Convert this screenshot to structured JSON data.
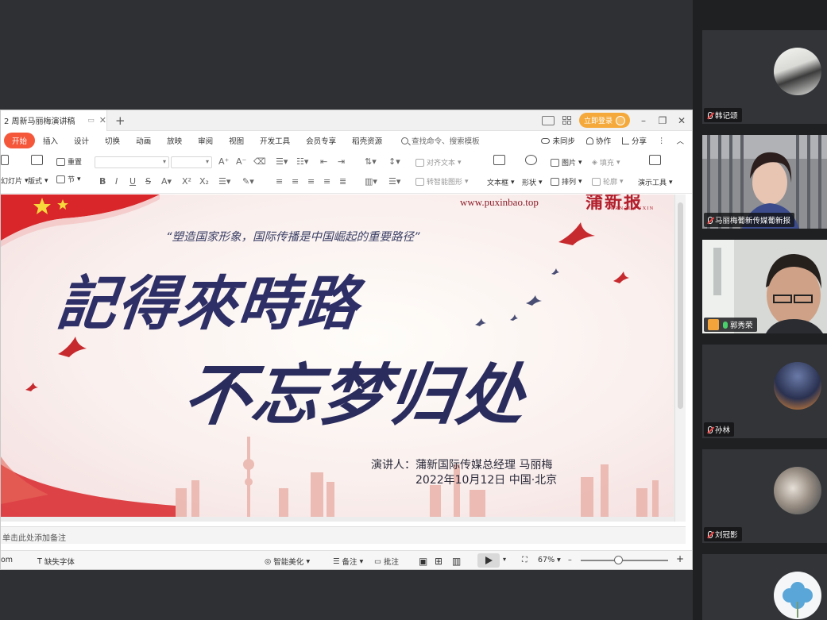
{
  "wps": {
    "doc_tab_title": "2 周新马丽梅演讲稿",
    "login_button": "立即登录",
    "menu": {
      "items": [
        "开始",
        "插入",
        "设计",
        "切换",
        "动画",
        "放映",
        "审阅",
        "视图",
        "开发工具",
        "会员专享",
        "稻壳资源"
      ],
      "active_index": 0,
      "search_placeholder": "查找命令、搜索模板",
      "sync": "未同步",
      "collab": "协作",
      "share": "分享"
    },
    "toolbar": {
      "new_slide": "幻灯片",
      "layout": "版式",
      "reset": "重置",
      "section": "节",
      "align_text": "对齐文本",
      "convert_smartart": "转智能图形",
      "textbox": "文本框",
      "shape": "形状",
      "picture": "图片",
      "fill": "填充",
      "arrange": "排列",
      "outline": "轮廓",
      "presenter_tools": "演示工具"
    },
    "notes_placeholder": "单击此处添加备注",
    "status": {
      "left_text": "om",
      "missing_fonts": "缺失字体",
      "beautify": "智能美化",
      "notes": "备注",
      "comments": "批注",
      "zoom": "67%"
    }
  },
  "slide": {
    "website": "www.puxinbao.top",
    "brand": "蒲新报",
    "brand_sub": "JORNAL PUXIN",
    "quote": "“塑造国家形象，国际传播是中国崛起的重要路径”",
    "title_line1": "記得來時路",
    "title_line2": "不忘梦归处",
    "speaker": "演讲人：蒲新国际传媒总经理 马丽梅",
    "date_location": "2022年10月12日  中国·北京"
  },
  "participants": [
    {
      "name": "韩记颂",
      "type": "avatar",
      "mic": "muted"
    },
    {
      "name": "马丽梅葡新传媒葡新报",
      "type": "video",
      "mic": "muted"
    },
    {
      "name": "郭秀荣",
      "type": "video",
      "mic": "on",
      "host": true
    },
    {
      "name": "孙林",
      "type": "avatar",
      "mic": "muted"
    },
    {
      "name": "刘冠影",
      "type": "avatar",
      "mic": "muted"
    },
    {
      "name": "",
      "type": "avatar",
      "mic": "muted"
    }
  ],
  "colors": {
    "active_menu": "#f5573b",
    "login_btn": "#f4a93a",
    "title_ink": "#2e2f66",
    "brand_red": "#b3202d",
    "panel_bg": "#1f2022"
  }
}
